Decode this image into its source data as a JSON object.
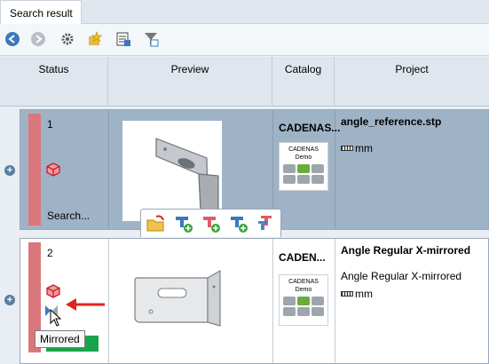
{
  "tab": {
    "label": "Search result"
  },
  "toolbar": {
    "icons": [
      "back-arrow-icon",
      "forward-arrow-icon",
      "settings-gear-icon",
      "favorites-star-icon",
      "export-table-icon",
      "filter-table-icon"
    ]
  },
  "columns": {
    "status": "Status",
    "preview": "Preview",
    "catalog": "Catalog",
    "project": "Project"
  },
  "rows": [
    {
      "number": "1",
      "status_text": "Search...",
      "catalog_title": "CADENAS...",
      "logo_text": "CADENAS\nDemo",
      "project_title": "angle_reference.stp",
      "unit": "mm"
    },
    {
      "number": "2",
      "catalog_title": "CADEN...",
      "logo_text": "CADENAS\nDemo",
      "project_title": "Angle Regular X-mirrored",
      "project_subtitle": "Angle Regular X-mirrored",
      "unit": "mm"
    }
  ],
  "tooltip": {
    "text": "Mirrored"
  },
  "colors": {
    "status_red": "#d9777c",
    "row_selected": "#9fb3c7",
    "arrow_red": "#e2231a",
    "status_green": "#1aa34a"
  }
}
